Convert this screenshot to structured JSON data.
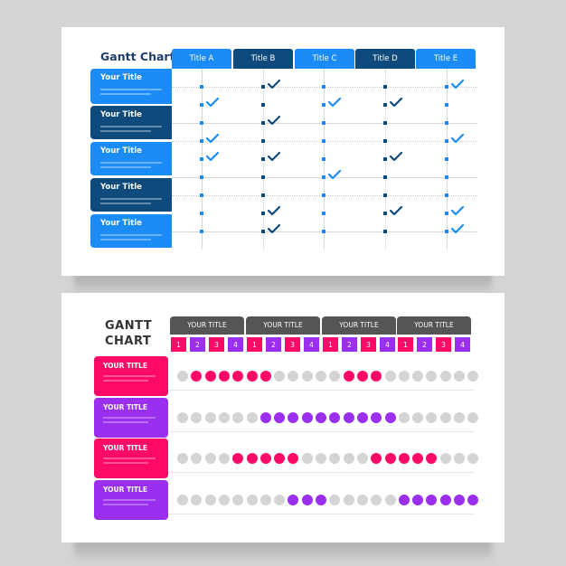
{
  "colors": {
    "page_bg": "#d3d4d6",
    "light_blue": "#1b8cf5",
    "dark_blue": "#0f4a7c",
    "pink": "#ff0a66",
    "purple": "#9b2ff0",
    "dot_grey": "#d4d4d6",
    "header_grey": "#555557"
  },
  "top_chart": {
    "title": "Gantt Chart",
    "columns": [
      {
        "label": "Title A",
        "tone": "light"
      },
      {
        "label": "Title B",
        "tone": "dark"
      },
      {
        "label": "Title C",
        "tone": "light"
      },
      {
        "label": "Title D",
        "tone": "dark"
      },
      {
        "label": "Title E",
        "tone": "light"
      }
    ],
    "rows": [
      {
        "label": "Your Title",
        "tone": "light"
      },
      {
        "label": "Your Title",
        "tone": "dark"
      },
      {
        "label": "Your Title",
        "tone": "light"
      },
      {
        "label": "Your Title",
        "tone": "dark"
      },
      {
        "label": "Your Title",
        "tone": "light"
      }
    ],
    "slot_count": 9,
    "checks": [
      [
        1,
        3,
        4
      ],
      [
        0,
        2,
        4,
        7,
        8
      ],
      [
        1,
        5
      ],
      [
        1,
        4,
        7
      ],
      [
        0,
        3,
        7,
        8
      ]
    ]
  },
  "bottom_chart": {
    "title_line1": "GANTT",
    "title_line2": "CHART",
    "groups": [
      {
        "label": "YOUR TITLE",
        "numbers": [
          "1",
          "2",
          "3",
          "4"
        ]
      },
      {
        "label": "YOUR TITLE",
        "numbers": [
          "1",
          "2",
          "3",
          "4"
        ]
      },
      {
        "label": "YOUR TITLE",
        "numbers": [
          "1",
          "2",
          "3",
          "4"
        ]
      },
      {
        "label": "YOUR TITLE",
        "numbers": [
          "1",
          "2",
          "3",
          "4"
        ]
      }
    ],
    "dots_per_row": 22,
    "rows": [
      {
        "label": "YOUR TITLE",
        "color": "pink",
        "active": [
          [
            1,
            6
          ],
          [
            12,
            14
          ]
        ]
      },
      {
        "label": "YOUR TITLE",
        "color": "purple",
        "active": [
          [
            6,
            15
          ]
        ]
      },
      {
        "label": "YOUR TITLE",
        "color": "pink",
        "active": [
          [
            4,
            8
          ],
          [
            14,
            18
          ]
        ]
      },
      {
        "label": "YOUR TITLE",
        "color": "purple",
        "active": [
          [
            8,
            10
          ],
          [
            16,
            21
          ]
        ]
      }
    ]
  }
}
